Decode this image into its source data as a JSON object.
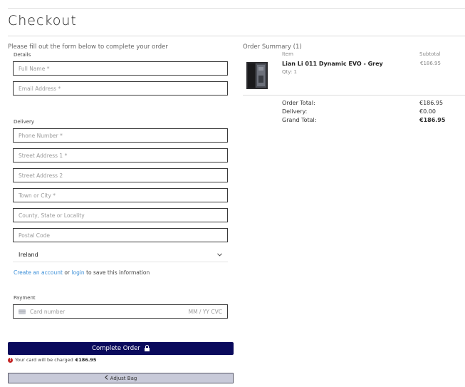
{
  "page": {
    "title": "Checkout",
    "intro": "Please fill out the form below to complete your order"
  },
  "details": {
    "label": "Details",
    "full_name_placeholder": "Full Name *",
    "email_placeholder": "Email Address *"
  },
  "delivery": {
    "label": "Delivery",
    "phone_placeholder": "Phone Number *",
    "street1_placeholder": "Street Address 1 *",
    "street2_placeholder": "Street Address 2",
    "town_placeholder": "Town or City *",
    "county_placeholder": "County, State or Locality",
    "postcode_placeholder": "Postal Code",
    "country_value": "Ireland"
  },
  "save_info": {
    "create_account": "Create an account",
    "or": "or",
    "login": "login",
    "suffix": "to save this information"
  },
  "payment": {
    "label": "Payment",
    "card_placeholder": "Card number",
    "expiry_cvc_placeholder": "MM / YY  CVC"
  },
  "actions": {
    "complete_label": "Complete Order",
    "charge_text": "Your card will be charged",
    "charge_amount": "€186.95",
    "adjust_bag_label": "Adjust Bag"
  },
  "summary": {
    "title": "Order Summary (1)",
    "col_item": "Item",
    "col_subtotal": "Subtotal",
    "items": [
      {
        "name": "Lian Li 011 Dynamic EVO - Grey",
        "qty": "Qty: 1",
        "subtotal": "€186.95"
      }
    ],
    "order_total_label": "Order Total:",
    "order_total_value": "€186.95",
    "delivery_label": "Delivery:",
    "delivery_value": "€0.00",
    "grand_total_label": "Grand Total:",
    "grand_total_value": "€186.95"
  },
  "colors": {
    "primary_button": "#0a0a5c",
    "secondary_button": "#c8cad9",
    "link": "#3b8fd8",
    "warning": "#c62828"
  },
  "icons": [
    "lock-icon",
    "card-icon",
    "warning-icon",
    "chevron-left-icon",
    "chevron-down-icon"
  ]
}
